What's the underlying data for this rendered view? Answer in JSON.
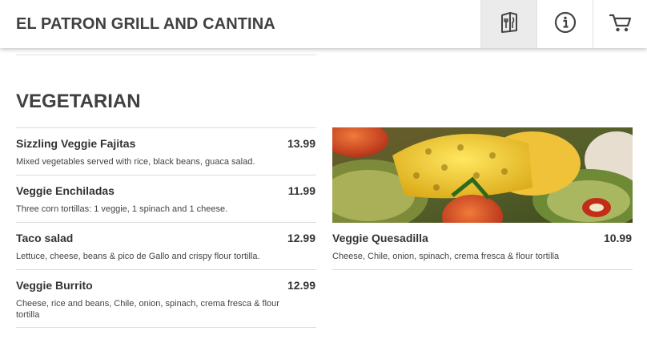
{
  "header": {
    "brand": "EL PATRON GRILL AND CANTINA",
    "buttons": [
      {
        "icon": "menu-book-icon",
        "active": true
      },
      {
        "icon": "info-icon",
        "active": false
      },
      {
        "icon": "cart-icon",
        "active": false
      }
    ]
  },
  "section": {
    "title": "VEGETARIAN"
  },
  "items": [
    {
      "name": "Sizzling Veggie Fajitas",
      "price": "13.99",
      "desc": "Mixed vegetables served with rice, black beans, guaca salad."
    },
    {
      "name": "Veggie Enchiladas",
      "price": "11.99",
      "desc": "Three corn tortillas: 1 veggie, 1 spinach and 1 cheese."
    },
    {
      "name": "Taco salad",
      "price": "12.99",
      "desc": "Lettuce, cheese, beans & pico de Gallo and crispy flour tortilla."
    },
    {
      "name": "Veggie Burrito",
      "price": "12.99",
      "desc": "Cheese, rice and beans, Chile, onion, spinach, crema fresca & flour tortilla"
    }
  ],
  "featured": {
    "name": "Veggie Quesadilla",
    "price": "10.99",
    "desc": "Cheese, Chile, onion, spinach, crema fresca & flour tortilla",
    "image": "grilled-vegetables-photo"
  },
  "colors": {
    "text": "#333333",
    "brand": "#404040",
    "divider": "#dcdcdc",
    "active_button_bg": "#ebebeb"
  }
}
